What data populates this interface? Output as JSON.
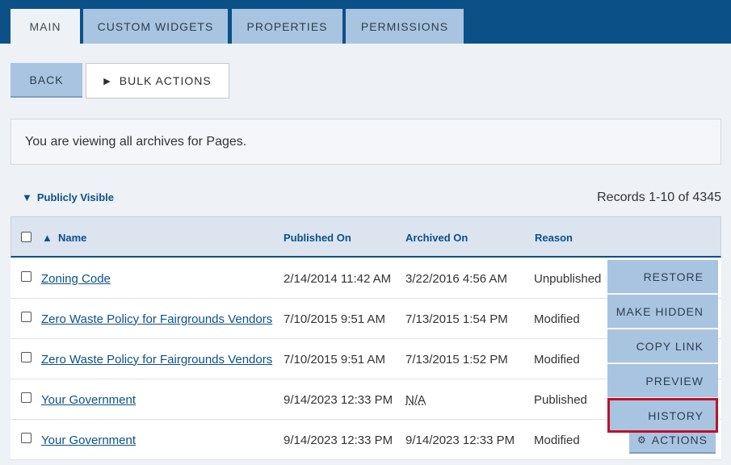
{
  "tabs": [
    {
      "label": "MAIN"
    },
    {
      "label": "CUSTOM WIDGETS"
    },
    {
      "label": "PROPERTIES"
    },
    {
      "label": "PERMISSIONS"
    }
  ],
  "toolbar": {
    "back_label": "BACK",
    "bulk_label": "BULK ACTIONS"
  },
  "info_text": "You are viewing all archives for Pages.",
  "filter_label": "Publicly Visible",
  "records_text": "Records 1-10 of 4345",
  "columns": {
    "name": "Name",
    "published": "Published On",
    "archived": "Archived On",
    "reason": "Reason"
  },
  "rows": [
    {
      "name": "Zoning Code",
      "published": "2/14/2014 11:42 AM",
      "archived": "3/22/2016 4:56 AM",
      "reason": "Unpublished"
    },
    {
      "name": "Zero Waste Policy for Fairgrounds Vendors",
      "published": "7/10/2015 9:51 AM",
      "archived": "7/13/2015 1:54 PM",
      "reason": "Modified"
    },
    {
      "name": "Zero Waste Policy for Fairgrounds Vendors",
      "published": "7/10/2015 9:51 AM",
      "archived": "7/13/2015 1:52 PM",
      "reason": "Modified"
    },
    {
      "name": "Your Government",
      "published": "9/14/2023 12:33 PM",
      "archived": "N/A",
      "reason": "Published"
    },
    {
      "name": "Your Government",
      "published": "9/14/2023 12:33 PM",
      "archived": "9/14/2023 12:33 PM",
      "reason": "Modified"
    }
  ],
  "actions_menu": [
    "RESTORE",
    "MAKE HIDDEN",
    "COPY LINK",
    "PREVIEW",
    "HISTORY"
  ],
  "actions_button_label": "ACTIONS",
  "colors": {
    "brand": "#0b5188",
    "button": "#a9c4e0",
    "highlight": "#c0102b"
  }
}
